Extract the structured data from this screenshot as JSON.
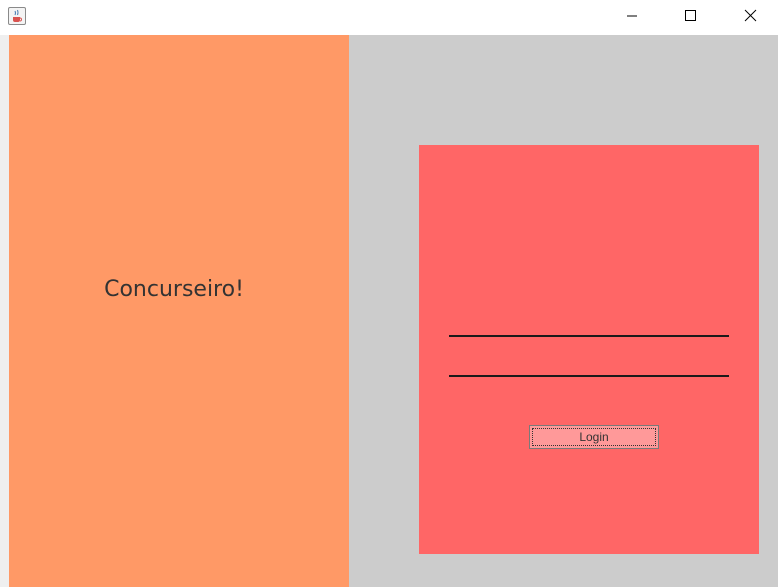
{
  "window": {
    "app_icon": "java-cup-icon",
    "controls": [
      "minimize-icon",
      "maximize-icon",
      "close-icon"
    ]
  },
  "brand": {
    "title": "Concurseiro!",
    "background_color": "#FF9966"
  },
  "login": {
    "background_color": "#FF6666",
    "username_value": "",
    "password_value": "",
    "button_label": "Login",
    "button_color": "#FF9999"
  },
  "colors": {
    "content_background": "#CCCCCC",
    "text": "#333333"
  }
}
